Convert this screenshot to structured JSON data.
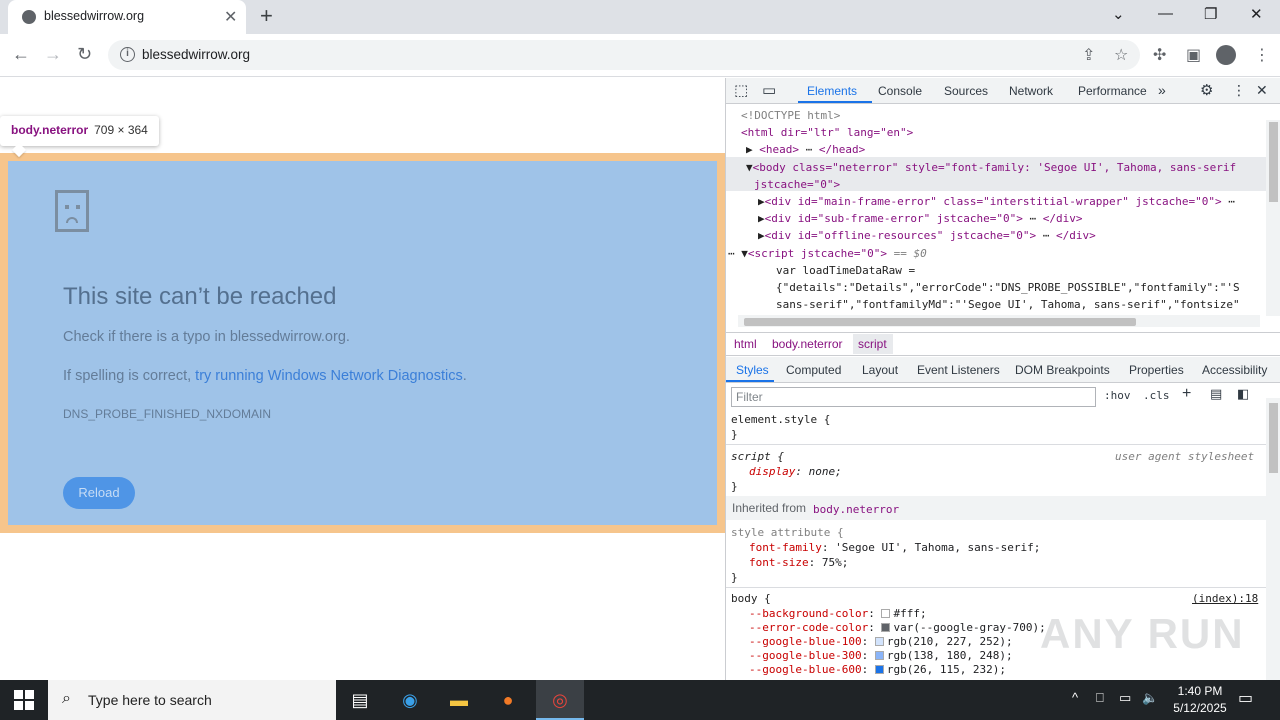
{
  "browser": {
    "tab_title": "blessedwirrow.org",
    "url": "blessedwirrow.org"
  },
  "page": {
    "tooltip_tag": "body.neterror",
    "tooltip_dims": "709 × 364",
    "title": "This site can’t be reached",
    "line1": "Check if there is a typo in blessedwirrow.org.",
    "line2_prefix": "If spelling is correct, ",
    "line2_link": "try running Windows Network Diagnostics",
    "line2_suffix": ".",
    "error_code": "DNS_PROBE_FINISHED_NXDOMAIN",
    "reload_label": "Reload"
  },
  "devtools": {
    "tabs": [
      "Elements",
      "Console",
      "Sources",
      "Network",
      "Performance"
    ],
    "active_tab": "Elements",
    "dom": {
      "doctype": "<!DOCTYPE html>",
      "html_open": "<html dir=\"ltr\" lang=\"en\">",
      "head": "<head>",
      "head_close": "</head>",
      "body_open": "<body class=\"neterror\" style=\"font-family: 'Segoe UI', Tahoma, sans-serif",
      "body_cont": "jstcache=\"0\">",
      "div1": "<div id=\"main-frame-error\" class=\"interstitial-wrapper\" jstcache=\"0\">",
      "div2": "<div id=\"sub-frame-error\" jstcache=\"0\">",
      "div2_close": "</div>",
      "div3": "<div id=\"offline-resources\" jstcache=\"0\">",
      "div3_close": "</div>",
      "script_open": "<script jstcache=\"0\">",
      "script_marker": "== $0",
      "script_l1": "var loadTimeDataRaw =",
      "script_l2": "{\"details\":\"Details\",\"errorCode\":\"DNS_PROBE_POSSIBLE\",\"fontfamily\":\"'S",
      "script_l3": "sans-serif\",\"fontfamilyMd\":\"'Segoe UI', Tahoma, sans-serif\",\"fontsize\""
    },
    "breadcrumbs": [
      "html",
      "body.neterror",
      "script"
    ],
    "styles_tabs": [
      "Styles",
      "Computed",
      "Layout",
      "Event Listeners",
      "DOM Breakpoints",
      "Properties",
      "Accessibility"
    ],
    "filter_placeholder": "Filter",
    "filter_hov": ":hov",
    "filter_cls": ".cls",
    "rules": {
      "element_style": "element.style {",
      "close": "}",
      "script_sel": "script {",
      "script_src": "user agent stylesheet",
      "script_prop": "display",
      "script_val": "none;",
      "inherited_label": "Inherited from",
      "inherited_from": "body.neterror",
      "style_attr": "style attribute {",
      "ff_prop": "font-family",
      "ff_val": "'Segoe UI', Tahoma, sans-serif;",
      "fs_prop": "font-size",
      "fs_val": "75%;",
      "body_sel": "body {",
      "body_src": "(index):18",
      "vars": [
        {
          "prop": "--background-color",
          "val": "#fff;",
          "color": "#ffffff"
        },
        {
          "prop": "--error-code-color",
          "val": "var(--google-gray-700);",
          "color": "#5f6368"
        },
        {
          "prop": "--google-blue-100",
          "val": "rgb(210, 227, 252);",
          "color": "#d2e3fc"
        },
        {
          "prop": "--google-blue-300",
          "val": "rgb(138, 180, 248);",
          "color": "#8ab4f8"
        },
        {
          "prop": "--google-blue-600",
          "val": "rgb(26, 115, 232);",
          "color": "#1a73e8"
        }
      ]
    }
  },
  "taskbar": {
    "search_placeholder": "Type here to search",
    "time": "1:40 PM",
    "date": "5/12/2025"
  },
  "watermark": "ANY RUN"
}
